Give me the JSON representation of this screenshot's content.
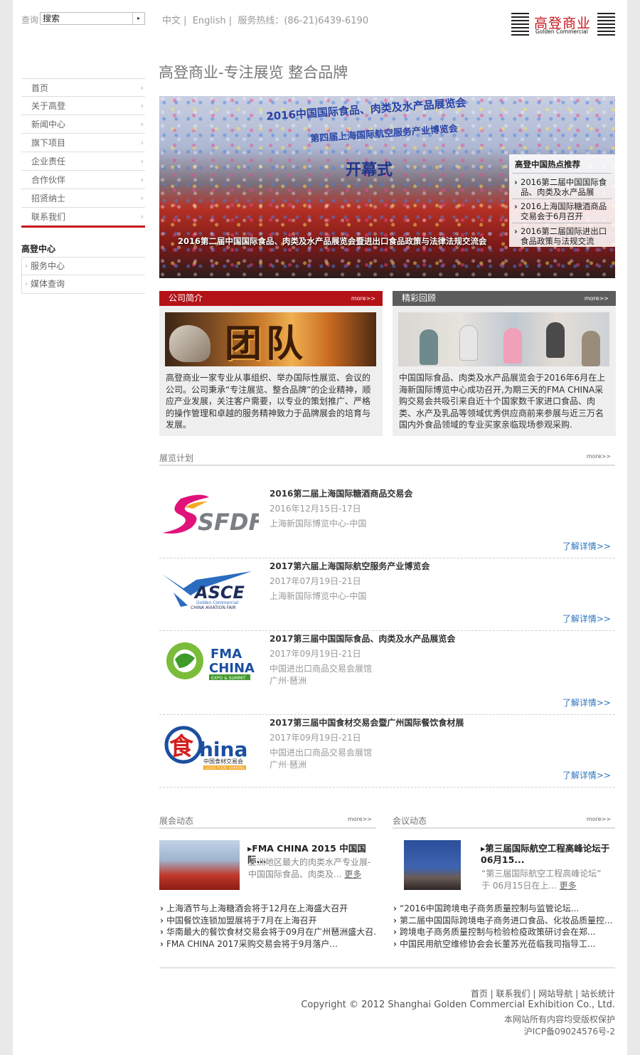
{
  "header": {
    "search_label": "查询",
    "search_value": "搜索",
    "search_button": "▸",
    "lang_cn": "中文",
    "lang_en": "English",
    "hotline": "服务热线：(86-21)6439-6190",
    "sep": "|",
    "logo_cn": "高登商业",
    "logo_en": "Golden Commercial"
  },
  "page_title": "高登商业-专注展览 整合品牌",
  "sidebar": {
    "items": [
      {
        "label": "首页"
      },
      {
        "label": "关于高登"
      },
      {
        "label": "新闻中心"
      },
      {
        "label": "旗下项目"
      },
      {
        "label": "企业责任"
      },
      {
        "label": "合作伙伴"
      },
      {
        "label": "招贤纳士"
      },
      {
        "label": "联系我们"
      }
    ],
    "section_title": "高登中心",
    "sub_items": [
      {
        "label": "服务中心"
      },
      {
        "label": "媒体查询"
      }
    ]
  },
  "banner": {
    "headline": "2016中国国际食品、肉类及水产品展览会",
    "headline2": "第四届上海国际航空服务产业博览会",
    "kaimu": "开幕式",
    "caption": "2016第二届中国国际食品、肉类及水产品展览会暨进出口食品政策与法律法规交流会",
    "hot_title": "高登中国热点推荐",
    "hot_items": [
      {
        "label": "2016第二届中国国际食品、肉类及水产品展"
      },
      {
        "label": "2016上海国际糖酒商品交易会于6月召开"
      },
      {
        "label": "2016第二届国际进出口食品政策与法规交流"
      }
    ]
  },
  "intro": {
    "title": "公司简介",
    "more": "more>>",
    "image_word": "团队",
    "text": "高登商业一家专业从事组织、举办国际性展览、会议的公司。公司秉承“专注展览、整合品牌”的企业精神，顺应产业发展，关注客户需要，以专业的策划推广、严格的操作管理和卓越的服务精神致力于品牌展会的培育与发展。"
  },
  "review": {
    "title": "精彩回顾",
    "more": "more>>",
    "text": "中国国际食品、肉类及水产品展览会于2016年6月在上海新国际博览中心成功召开,为期三天的FMA CHINA采购交易会共吸引来自近十个国家数千家进口食品、肉类、水产及乳品等领域优秀供应商前来参展与近三万名国内外食品领域的专业买家亲临现场参观采购."
  },
  "expo_plan": {
    "title": "展览计划",
    "more": "more>>",
    "detail": "了解详情>>",
    "items": [
      {
        "logo": "SFDF",
        "title": "2016第二届上海国际糖酒商品交易会",
        "date": "2016年12月15日-17日",
        "venue": "上海新国际博览中心-中国",
        "venue2": ""
      },
      {
        "logo": "ASCE",
        "logo_sub": "Golden Commercial",
        "logo_sub2": "CHINA AVIATION FAIR",
        "title": "2017第六届上海国际航空服务产业博览会",
        "date": "2017年07月19日-21日",
        "venue": "上海新国际博览中心-中国",
        "venue2": ""
      },
      {
        "logo": "FMA",
        "logo2": "CHINA",
        "logo_sub": "EXPO & SUMMIT",
        "title": "2017第三届中国国际食品、肉类及水产品展览会",
        "date": "2017年09月19日-21日",
        "venue": "中国进出口商品交易会展馆",
        "venue2": "广州·琶洲"
      },
      {
        "logo": "食",
        "logo2": "hina",
        "logo_sub": "中国食材交易会",
        "logo_sub2": "GOOD FOOD SHARING",
        "title": "2017第三届中国食材交易会暨广州国际餐饮食材展",
        "date": "2017年09月19日-21日",
        "venue": "中国进出口商品交易会展馆",
        "venue2": "广州·琶洲"
      }
    ]
  },
  "expo_news": {
    "title": "展会动态",
    "more": "more>>",
    "feature_title": "FMA CHINA 2015 中国国际...",
    "feature_desc1": "亚洲地区最大的肉类水产专业展-",
    "feature_desc2": "中国国际食品、肉类及...",
    "feature_more": "更多",
    "items": [
      {
        "label": "上海酒节与上海糖酒会将于12月在上海盛大召开"
      },
      {
        "label": "中国餐饮连锁加盟展将于7月在上海召开"
      },
      {
        "label": "华南最大的餐饮食材交易会将于09月在广州琶洲盛大召..."
      },
      {
        "label": "FMA CHINA 2017采购交易会将于9月落户..."
      }
    ]
  },
  "conf_news": {
    "title": "会议动态",
    "more": "more>>",
    "feature_title1": "第三届国际航空工程高峰论坛于",
    "feature_title2": "06月15...",
    "feature_desc1": "“第三届国际航空工程高峰论坛”",
    "feature_desc2": "于 06月15日在上...",
    "feature_more": "更多",
    "items": [
      {
        "label": "“2016中国跨境电子商务质量控制与监管论坛..."
      },
      {
        "label": "第二届中国国际跨境电子商务进口食品、化妆品质量控..."
      },
      {
        "label": "跨境电子商务质量控制与检验检疫政策研讨会在郑..."
      },
      {
        "label": "中国民用航空维修协会会长董苏光莅临我司指导工..."
      }
    ]
  },
  "footer": {
    "links": [
      "首页",
      "联系我们",
      "网站导航",
      "站长统计"
    ],
    "sep": "|",
    "copyright": "Copyright © 2012 Shanghai Golden Commercial Exhibition Co., Ltd.",
    "rights": "本网站所有内容均受版权保护",
    "icp": "沪ICP备09024576号-2"
  },
  "colors": {
    "brand_red": "#c8161d",
    "link_blue": "#2c75c0",
    "header_grey": "#5c5c5c"
  }
}
